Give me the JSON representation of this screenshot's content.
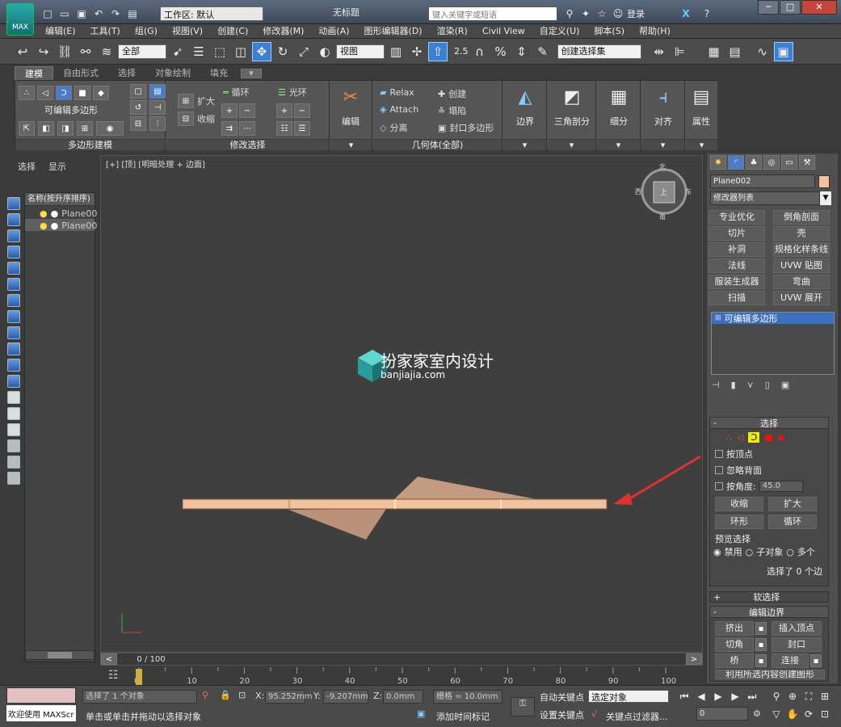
{
  "title_bar": {
    "workspace_label": "工作区: 默认",
    "window_title": "无标题",
    "search_placeholder": "键入关键字或短语",
    "login": "登录",
    "logo_text": "MAX",
    "help": "?"
  },
  "menu": [
    "编辑(E)",
    "工具(T)",
    "组(G)",
    "视图(V)",
    "创建(C)",
    "修改器(M)",
    "动画(A)",
    "图形编辑器(D)",
    "渲染(R)",
    "Civil View",
    "自定义(U)",
    "脚本(S)",
    "帮助(H)"
  ],
  "main_toolbar": {
    "filter_value": "全部",
    "view_value": "视图",
    "snap_angle": "2.5",
    "named_selection": "创建选择集"
  },
  "ribbon_tabs": [
    "建模",
    "自由形式",
    "选择",
    "对象绘制",
    "填充"
  ],
  "ribbon": {
    "group1_label": "多边形建模",
    "editable_poly": "可编辑多边形",
    "group2_label": "修改选择",
    "expand": "扩大",
    "shrink": "收缩",
    "loop": "循环",
    "ring": "光环",
    "edit": "编辑",
    "relax": "Relax",
    "attach": "Attach",
    "detach": "分离",
    "create": "创建",
    "collapse": "塌陷",
    "cap_poly": "封口多边形",
    "group3_label": "几何体(全部)",
    "border": "边界",
    "tri_split": "三角剖分",
    "subdivide": "细分",
    "align": "对齐",
    "properties": "属性"
  },
  "scene_explorer": {
    "tabs": [
      "选择",
      "显示"
    ],
    "header": "名称(按升序排序)",
    "items": [
      "Plane00",
      "Plane00"
    ]
  },
  "viewport": {
    "label": "[+] [顶] [明暗处理 + 边面]",
    "watermark_title": "扮家家室内设计",
    "watermark_url": "banjiajia.com",
    "compass": {
      "n": "北",
      "s": "南",
      "e": "东",
      "w": "西",
      "face": "上"
    }
  },
  "timeline": {
    "frame": "0 / 100",
    "ticks": [
      "0",
      "10",
      "20",
      "30",
      "40",
      "50",
      "60",
      "70",
      "80",
      "90",
      "100"
    ]
  },
  "command_panel": {
    "object_name": "Plane002",
    "modifier_list": "修改器列表",
    "modifier_buttons": [
      "专业优化",
      "倒角剖面",
      "切片",
      "壳",
      "补洞",
      "规格化样条线",
      "法线",
      "UVW 贴图",
      "服装生成器",
      "弯曲",
      "扫描",
      "UVW 展开"
    ],
    "stack_item": "可编辑多边形",
    "selection_rollout": "选择",
    "by_vertex": "按顶点",
    "ignore_backface": "忽略背面",
    "by_angle": "按角度:",
    "angle_value": "45.0",
    "shrink": "收缩",
    "grow": "扩大",
    "ring": "环形",
    "loop": "循环",
    "preview_title": "预览选择",
    "preview_off": "禁用",
    "preview_sub": "子对象",
    "preview_multi": "多个",
    "selected_info": "选择了 0 个边",
    "soft_selection": "软选择",
    "edit_border": "编辑边界",
    "extrude": "挤出",
    "insert_vertex": "插入顶点",
    "chamfer": "切角",
    "cap": "封口",
    "bridge": "桥",
    "connect": "连接",
    "create_shape": "利用所选内容创建图形"
  },
  "status": {
    "selected": "选择了 1 个对象",
    "hint": "单击或单击并拖动以选择对象",
    "welcome": "欢迎使用 MAXScr",
    "x_label": "X:",
    "x": "95.252mm",
    "y_label": "Y:",
    "y": "-9.207mm",
    "z_label": "Z:",
    "z": "0.0mm",
    "grid": "栅格 = 10.0mm",
    "add_tag": "添加时间标记",
    "auto_key": "自动关键点",
    "set_key": "设置关键点",
    "sel_obj": "选定对象",
    "key_filter": "关键点过滤器...",
    "frame_value": "0"
  }
}
